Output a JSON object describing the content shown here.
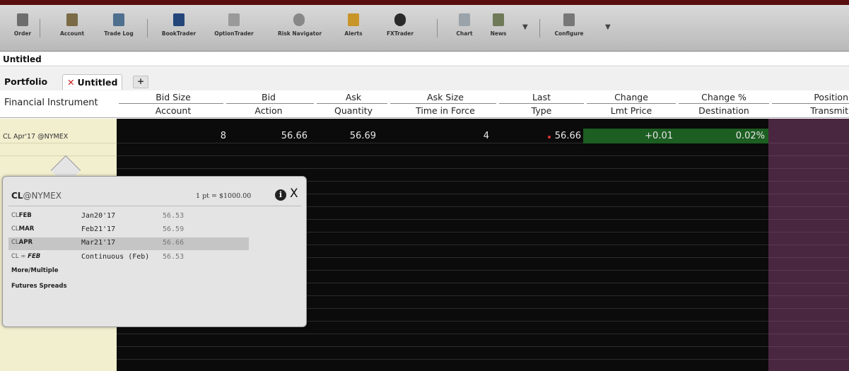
{
  "toolbar": {
    "items": [
      {
        "label": "Order",
        "icon": "order-icon"
      },
      {
        "label": "Account",
        "icon": "account-icon"
      },
      {
        "label": "Trade Log",
        "icon": "trade-log-icon"
      },
      {
        "label": "BookTrader",
        "icon": "booktrader-icon"
      },
      {
        "label": "OptionTrader",
        "icon": "optiontrader-icon"
      },
      {
        "label": "Risk Navigator",
        "icon": "risk-navigator-icon"
      },
      {
        "label": "Alerts",
        "icon": "alerts-icon"
      },
      {
        "label": "FXTrader",
        "icon": "fxtrader-icon"
      },
      {
        "label": "Chart",
        "icon": "chart-icon"
      },
      {
        "label": "News",
        "icon": "news-icon"
      },
      {
        "label": "Configure",
        "icon": "configure-icon"
      }
    ]
  },
  "window_title": "Untitled",
  "tabs": [
    {
      "label": "Portfolio"
    },
    {
      "label": "Untitled",
      "active": true,
      "close_glyph": "✕"
    }
  ],
  "add_tab_glyph": "+",
  "columns": {
    "financial_instrument": "Financial Instrument",
    "pairs": [
      {
        "top": "Bid Size",
        "bottom": "Account"
      },
      {
        "top": "Bid",
        "bottom": "Action"
      },
      {
        "top": "Ask",
        "bottom": "Quantity"
      },
      {
        "top": "Ask Size",
        "bottom": "Time in Force"
      },
      {
        "top": "Last",
        "bottom": "Type"
      },
      {
        "top": "Change",
        "bottom": "Lmt Price"
      },
      {
        "top": "Change %",
        "bottom": "Destination"
      },
      {
        "top": "Position",
        "bottom": "Transmit"
      }
    ]
  },
  "row": {
    "instrument": "CL Apr'17 @NYMEX",
    "bid_size": "8",
    "bid": "56.66",
    "ask": "56.69",
    "ask_size": "4",
    "last": "56.66",
    "change": "+0.01",
    "change_pct": "0.02%"
  },
  "colors": {
    "accent_dark": "#5a0d0f",
    "grid_bg": "#0b0b0b",
    "change_positive_bg": "#1d5e22",
    "position_col_bg": "#4a2740",
    "instrument_col_bg": "#f2efcf"
  },
  "popup": {
    "symbol": "CL",
    "exchange": "@NYMEX",
    "multiplier": "1 pt = $1000.00",
    "info_glyph": "i",
    "close_glyph": "X",
    "contracts": [
      {
        "prefix": "CL",
        "month": "FEB",
        "date": "Jan20'17",
        "price": "56.53",
        "selected": false
      },
      {
        "prefix": "CL",
        "month": "MAR",
        "date": "Feb21'17",
        "price": "56.59",
        "selected": false
      },
      {
        "prefix": "CL",
        "month": "APR",
        "date": "Mar21'17",
        "price": "56.66",
        "selected": true
      },
      {
        "prefix": "CL ∞",
        "month": "FEB",
        "date": "Continuous (Feb)",
        "price": "56.53",
        "selected": false
      }
    ],
    "links": [
      "More/Multiple",
      "Futures Spreads"
    ]
  }
}
